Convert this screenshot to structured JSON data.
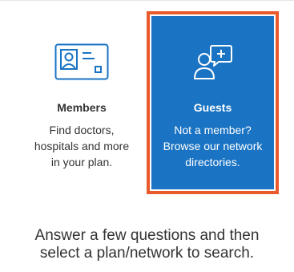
{
  "cards": {
    "members": {
      "title": "Members",
      "description_lines": [
        "Find doctors,",
        "hospitals and more",
        "in your plan."
      ],
      "icon": "id-card-icon"
    },
    "guests": {
      "title": "Guests",
      "description_lines": [
        "Not a member?",
        "Browse our network",
        "directories."
      ],
      "icon": "user-with-add-bubble-icon",
      "selected": true
    }
  },
  "instructions": {
    "line1": "Answer a few questions and then",
    "line2": "select a plan/network to search."
  },
  "colors": {
    "members_icon": "#1a73c3",
    "guests_background": "#1a73c3",
    "selected_border": "#e85a2c",
    "text": "#333333"
  }
}
